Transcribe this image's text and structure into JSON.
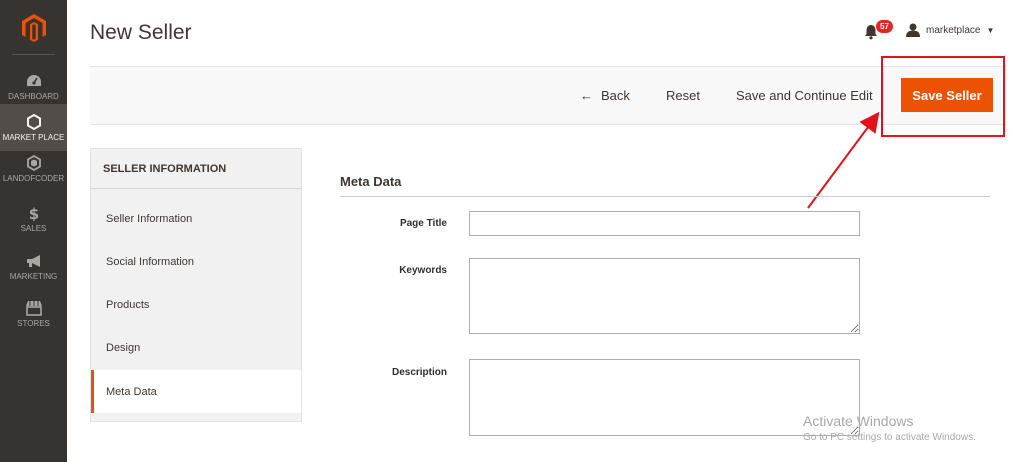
{
  "sidebar": {
    "items": [
      {
        "label": "DASHBOARD",
        "icon": "dashboard-gauge-icon"
      },
      {
        "label": "MARKET PLACE",
        "icon": "hexagon-icon"
      },
      {
        "label": "LANDOFCODER",
        "icon": "landofcoder-logo-icon"
      },
      {
        "label": "SALES",
        "icon": "dollar-icon"
      },
      {
        "label": "MARKETING",
        "icon": "megaphone-icon"
      },
      {
        "label": "STORES",
        "icon": "store-icon"
      }
    ]
  },
  "header": {
    "title": "New Seller",
    "notification_count": "57",
    "user_name": "marketplace"
  },
  "actions": {
    "back": "Back",
    "reset": "Reset",
    "save_continue": "Save and Continue Edit",
    "save": "Save Seller"
  },
  "tabs": {
    "title": "SELLER INFORMATION",
    "items": [
      {
        "label": "Seller Information"
      },
      {
        "label": "Social Information"
      },
      {
        "label": "Products"
      },
      {
        "label": "Design"
      },
      {
        "label": "Meta Data"
      }
    ]
  },
  "form": {
    "section_title": "Meta Data",
    "page_title_label": "Page Title",
    "page_title_value": "",
    "keywords_label": "Keywords",
    "keywords_value": "",
    "description_label": "Description",
    "description_value": ""
  },
  "watermark": {
    "line1": "Activate Windows",
    "line2": "Go to PC settings to activate Windows."
  },
  "colors": {
    "sidebar_bg": "#373330",
    "accent": "#eb5202",
    "annotation": "#e2111c"
  }
}
